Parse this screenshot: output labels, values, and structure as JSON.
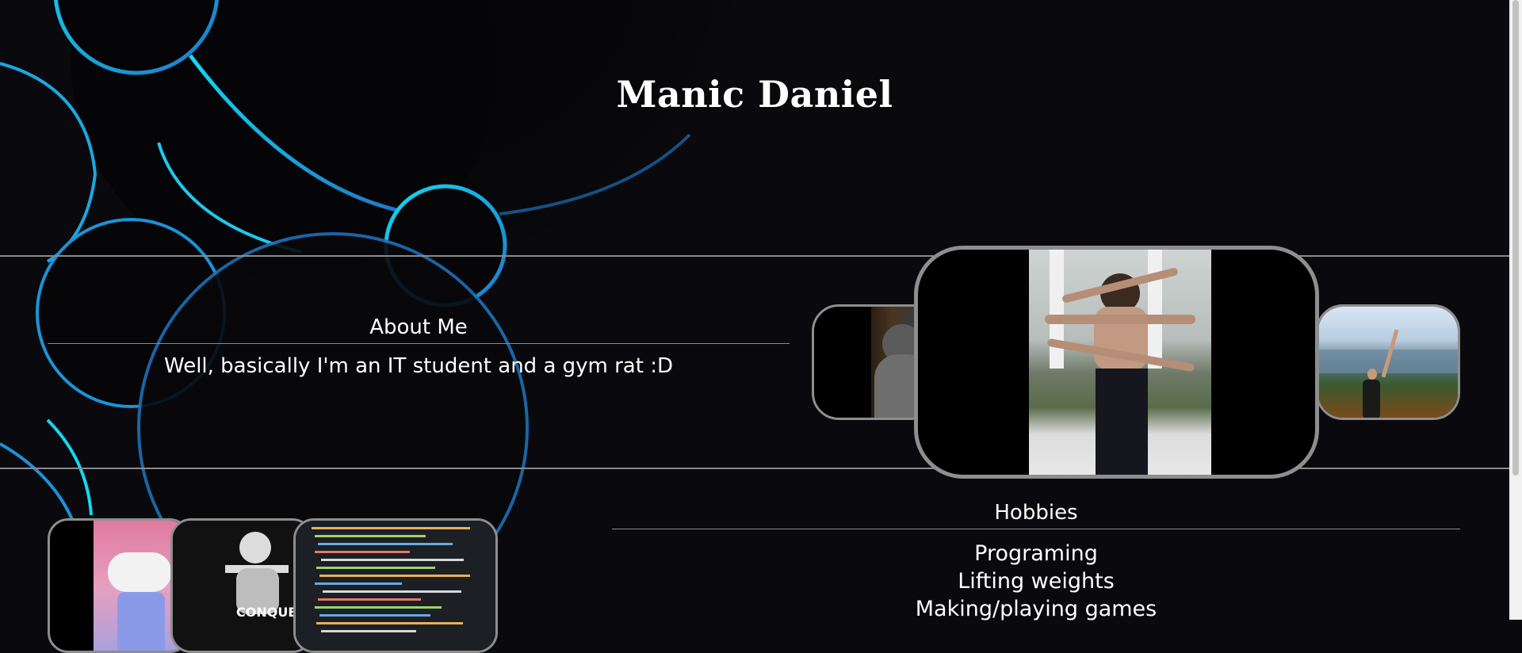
{
  "header": {
    "title": "Manic Daniel"
  },
  "about": {
    "heading": "About Me",
    "text": "Well, basically I'm an IT student and a gym rat :D"
  },
  "gallery": {
    "photos": [
      {
        "name": "hooded-portrait-photo"
      },
      {
        "name": "multi-arm-gym-photo"
      },
      {
        "name": "mountain-view-photo"
      }
    ]
  },
  "hobbies": {
    "heading": "Hobbies",
    "items": [
      "Programing",
      "Lifting weights",
      "Making/playing games"
    ]
  },
  "hobby_images": {
    "gym_caption": "CONQUE"
  },
  "colors": {
    "background": "#0a0a0e",
    "accent_cyan": "#13d9f2",
    "accent_blue": "#1e78c8",
    "border_gray": "#8e8e8e",
    "text": "#ffffff"
  }
}
